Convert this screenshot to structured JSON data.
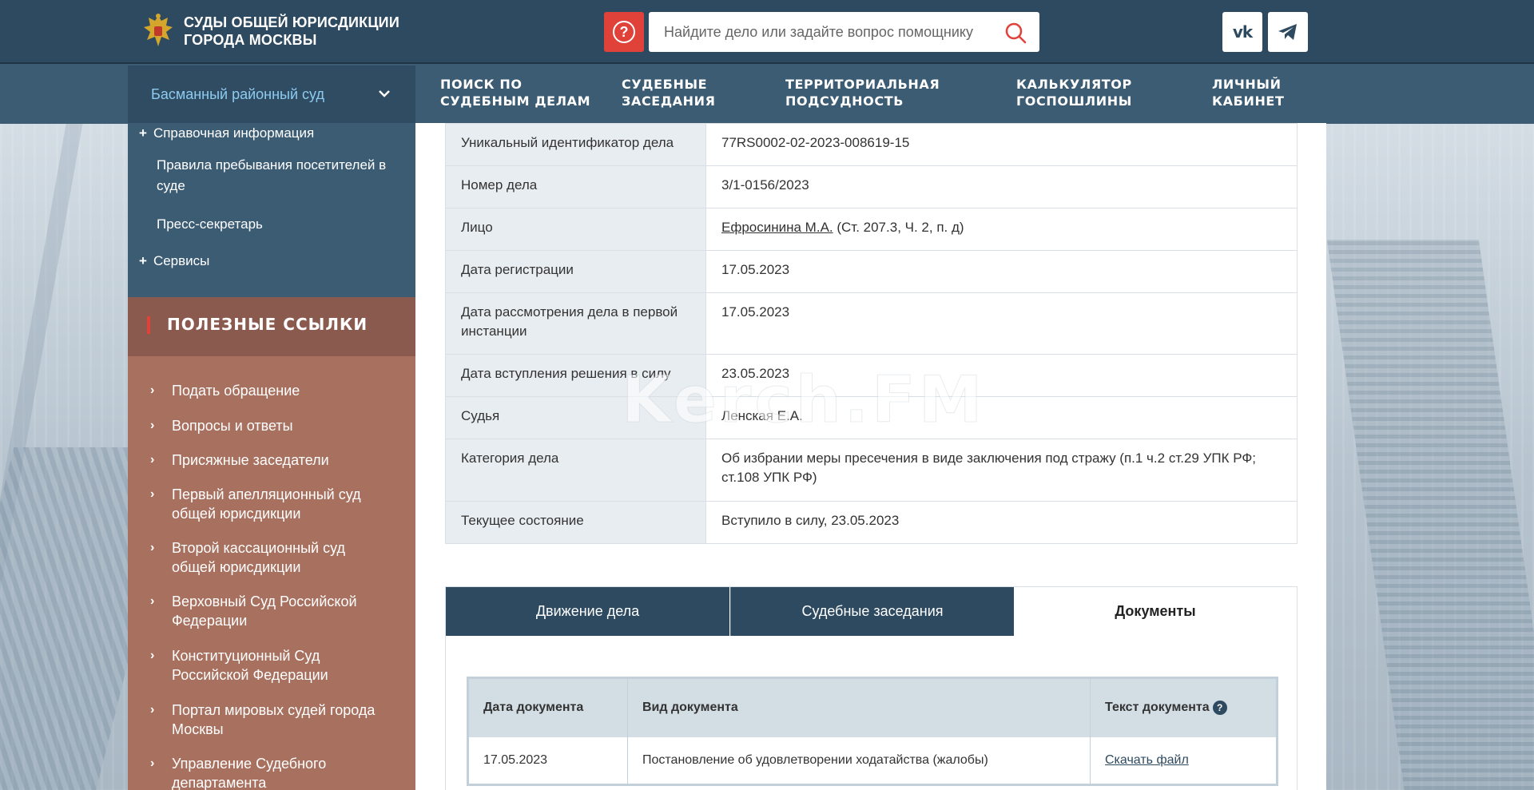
{
  "header": {
    "logo_line1": "СУДЫ ОБЩЕЙ ЮРИСДИКЦИИ",
    "logo_line2": "ГОРОДА МОСКВЫ",
    "search_placeholder": "Найдите дело или задайте вопрос помощнику",
    "help_symbol": "?",
    "vk_label": "vk",
    "colors": {
      "header": "#2e4a60",
      "help": "#e0423a"
    }
  },
  "nav": {
    "court": "Басманный районный суд",
    "items": [
      {
        "line1": "ПОИСК ПО",
        "line2": "СУДЕБНЫМ ДЕЛАМ"
      },
      {
        "line1": "СУДЕБНЫЕ",
        "line2": "ЗАСЕДАНИЯ"
      },
      {
        "line1": "ТЕРРИТОРИАЛЬНАЯ",
        "line2": "ПОДСУДНОСТЬ"
      },
      {
        "line1": "КАЛЬКУЛЯТОР",
        "line2": "ГОСПОШЛИНЫ"
      },
      {
        "line1": "ЛИЧНЫЙ",
        "line2": "КАБИНЕТ"
      }
    ]
  },
  "sidebar": {
    "info_items": [
      {
        "label": "Справочная информация",
        "plus": "+"
      },
      {
        "label": "Правила пребывания посетителей в суде"
      },
      {
        "label": "Пресс-секретарь"
      },
      {
        "label": "Сервисы",
        "plus": "+"
      }
    ],
    "useful_title": "ПОЛЕЗНЫЕ ССЫЛКИ",
    "useful_links": [
      "Подать обращение",
      "Вопросы и ответы",
      "Присяжные заседатели",
      "Первый апелляционный суд общей юрисдикции",
      "Второй кассационный суд общей юрисдикции",
      "Верховный Суд Российской Федерации",
      "Конституционный Суд Российской Федерации",
      "Портал мировых судей города Москвы",
      "Управление Судебного департамента"
    ],
    "arrow": "›"
  },
  "case": {
    "rows": [
      {
        "key": "Уникальный идентификатор дела",
        "value": "77RS0002-02-2023-008619-15"
      },
      {
        "key": "Номер дела",
        "value": "3/1-0156/2023"
      },
      {
        "key": "Лицо",
        "link": "Ефросинина М.А.",
        "value": " (Ст. 207.3, Ч. 2, п. д)"
      },
      {
        "key": "Дата регистрации",
        "value": "17.05.2023"
      },
      {
        "key": "Дата рассмотрения дела в первой инстанции",
        "value": "17.05.2023"
      },
      {
        "key": "Дата вступления решения в силу",
        "value": "23.05.2023"
      },
      {
        "key": "Судья",
        "value": "Ленская Е.А."
      },
      {
        "key": "Категория дела",
        "value": "Об избрании меры пресечения в виде заключения под стражу (п.1 ч.2 ст.29 УПК РФ; ст.108 УПК РФ)"
      },
      {
        "key": "Текущее состояние",
        "value": "Вступило в силу, 23.05.2023"
      }
    ],
    "watermark": "Kerch.FM"
  },
  "tabs": {
    "items": [
      "Движение дела",
      "Судебные заседания",
      "Документы"
    ],
    "active_index": 2
  },
  "documents": {
    "headers": [
      "Дата документа",
      "Вид документа",
      "Текст документа"
    ],
    "help_symbol": "?",
    "rows": [
      {
        "date": "17.05.2023",
        "type": "Постановление об удовлетворении ходатайства (жалобы)",
        "link": "Скачать файл"
      }
    ]
  }
}
